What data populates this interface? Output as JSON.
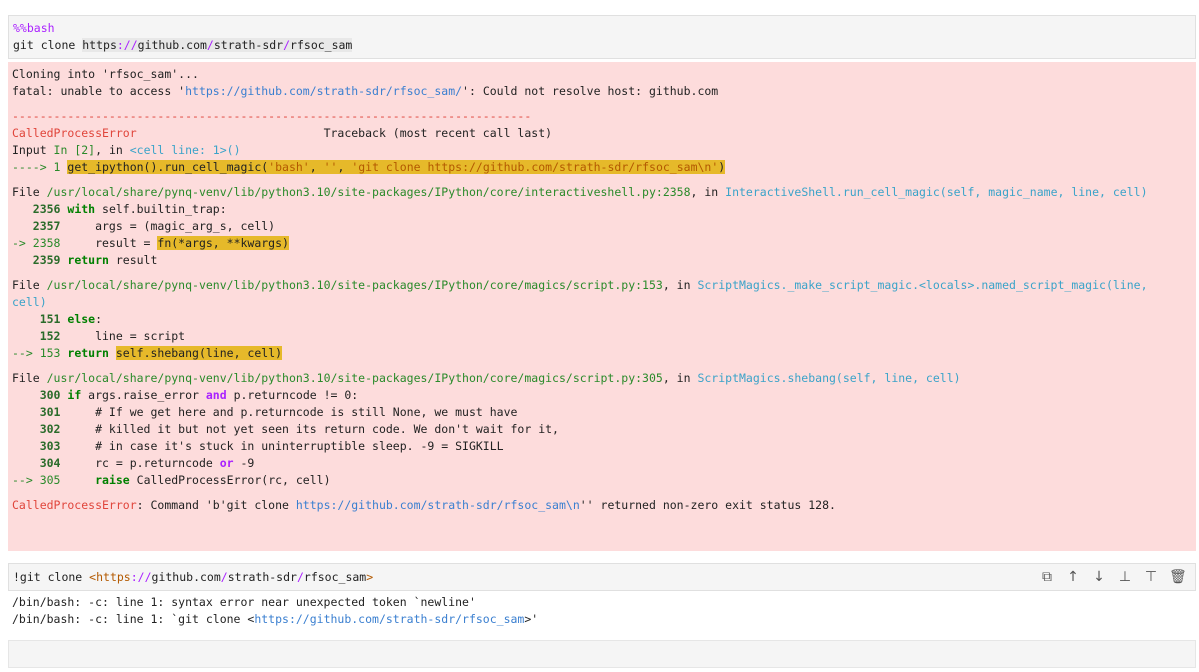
{
  "cell1": {
    "magic": "%%bash",
    "cmd_prefix": "git clone ",
    "url_http": "https",
    "url_sep": "://",
    "url_host": "github",
    "url_dot": ".",
    "url_com": "com",
    "url_slash": "/",
    "url_path1": "strath-sdr",
    "url_slash2": "/",
    "url_path2": "rfsoc_sam"
  },
  "error": {
    "l1": "Cloning into 'rfsoc_sam'...",
    "l2_a": "fatal: unable to access '",
    "l2_url": "https://github.com/strath-sdr/rfsoc_sam/",
    "l2_b": "': Could not resolve host: github.com",
    "dashes": "---------------------------------------------------------------------------",
    "exc_name": "CalledProcessError",
    "traceback": "Traceback (most recent call last)",
    "input_a": "Input ",
    "input_in": "In [2]",
    "input_b": ", in ",
    "input_loc": "<cell line: 1>()",
    "arrow1": "----> 1 ",
    "arrow1_code_a": "get_ipython().run_cell_magic(",
    "arrow1_s1": "'bash'",
    "arrow1_c1": ", ",
    "arrow1_s2": "''",
    "arrow1_c2": ", ",
    "arrow1_s3": "'git clone https://github.com/strath-sdr/rfsoc_sam\\n'",
    "arrow1_end": ")",
    "f1_a": "File ",
    "f1_path": "/usr/local/share/pynq-venv/lib/python3.10/site-packages/IPython/core/interactiveshell.py:2358",
    "f1_b": ", in ",
    "f1_func": "InteractiveShell.run_cell_magic(self, magic_name, line, cell)",
    "f1_l2356_n": "   2356 ",
    "f1_l2356_kw": "with",
    "f1_l2356_rest": " self.builtin_trap:",
    "f1_l2357_n": "   2357 ",
    "f1_l2357_rest": "    args = (magic_arg_s, cell)",
    "f1_l2358_n": "-> 2358 ",
    "f1_l2358_a": "    result = ",
    "f1_l2358_hl": "fn(*args, **kwargs)",
    "f1_l2359_n": "   2359 ",
    "f1_l2359_kw": "return",
    "f1_l2359_rest": " result",
    "f2_a": "File ",
    "f2_path": "/usr/local/share/pynq-venv/lib/python3.10/site-packages/IPython/core/magics/script.py:153",
    "f2_b": ", in ",
    "f2_func1": "ScriptMagics._make_script_magic.<locals>.named_script_magic(line,",
    "f2_func2": "cell)",
    "f2_l151_n": "    151 ",
    "f2_l151_kw": "else",
    "f2_l151_rest": ":",
    "f2_l152_n": "    152 ",
    "f2_l152_rest": "    line = script",
    "f2_l153_n": "--> 153 ",
    "f2_l153_kw": "return",
    "f2_l153_sp": " ",
    "f2_l153_hl": "self.shebang(line, cell)",
    "f3_a": "File ",
    "f3_path": "/usr/local/share/pynq-venv/lib/python3.10/site-packages/IPython/core/magics/script.py:305",
    "f3_b": ", in ",
    "f3_func": "ScriptMagics.shebang(self, line, cell)",
    "f3_l300_n": "    300 ",
    "f3_l300_kw": "if",
    "f3_l300_a": " args.raise_error ",
    "f3_l300_and": "and",
    "f3_l300_b": " p.returncode != 0:",
    "f3_l301_n": "    301 ",
    "f3_l301_rest": "    # If we get here and p.returncode is still None, we must have",
    "f3_l302_n": "    302 ",
    "f3_l302_rest": "    # killed it but not yet seen its return code. We don't wait for it,",
    "f3_l303_n": "    303 ",
    "f3_l303_rest": "    # in case it's stuck in uninterruptible sleep. -9 = SIGKILL",
    "f3_l304_n": "    304 ",
    "f3_l304_a": "    rc = p.returncode ",
    "f3_l304_or": "or",
    "f3_l304_b": " -9",
    "f3_l305_n": "--> 305 ",
    "f3_l305_sp": "    ",
    "f3_l305_kw": "raise",
    "f3_l305_rest": " CalledProcessError(rc, cell)",
    "final_exc": "CalledProcessError",
    "final_a": ": Command 'b'git clone ",
    "final_url": "https://github.com/strath-sdr/rfsoc_sam\\n",
    "final_b": "'' returned non-zero exit status 128."
  },
  "cell2": {
    "bang": "!git clone ",
    "lt": "<",
    "url_http": "https",
    "url_sep": "://",
    "url_host": "github",
    "url_dot": ".",
    "url_com": "com",
    "url_slash": "/",
    "url_path1": "strath-sdr",
    "url_slash2": "/",
    "url_path2": "rfsoc_sam",
    "gt": ">",
    "toolbar_icons": [
      "copy-icon",
      "move-up-icon",
      "move-down-icon",
      "insert-above-icon",
      "insert-below-icon",
      "delete-icon"
    ]
  },
  "out2": {
    "l1": "/bin/bash: -c: line 1: syntax error near unexpected token `newline'",
    "l2_a": "/bin/bash: -c: line 1: `git clone <",
    "l2_url": "https://github.com/strath-sdr/rfsoc_sam",
    "l2_b": ">'"
  }
}
